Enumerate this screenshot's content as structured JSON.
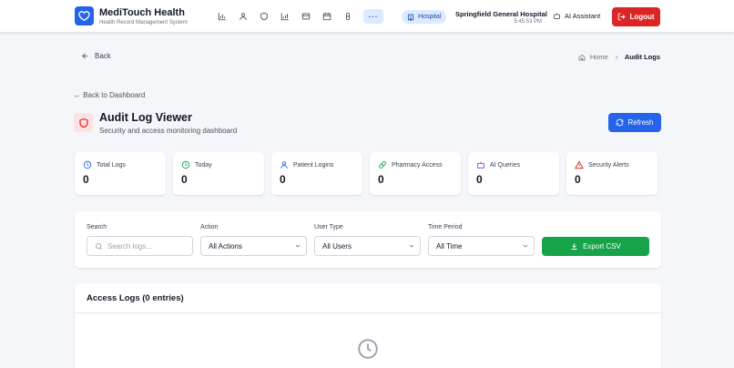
{
  "app": {
    "title": "MediTouch Health",
    "subtitle": "Health Record Management System",
    "nav_icons": [
      "bar-chart-icon",
      "user-icon",
      "shield-icon",
      "bar-chart-icon",
      "credit-card-icon",
      "calendar-icon",
      "pill-icon"
    ],
    "nav_more_label": "···",
    "hospital_badge": "Hospital",
    "hospital_name": "Springfield General Hospital",
    "time": "5:45:53 PM",
    "ai_assistant_label": "AI Assistant",
    "logout_label": "Logout"
  },
  "nav": {
    "back_label": "Back",
    "breadcrumb": {
      "home": "Home",
      "current": "Audit Logs"
    },
    "back_to_dashboard": "← Back to Dashboard"
  },
  "header": {
    "title": "Audit Log Viewer",
    "subtitle": "Security and access monitoring dashboard",
    "refresh_label": "Refresh"
  },
  "stats": [
    {
      "label": "Total Logs",
      "value": "0",
      "icon": "clock-icon",
      "color": "#2563eb"
    },
    {
      "label": "Today",
      "value": "0",
      "icon": "clock-icon",
      "color": "#16a34a"
    },
    {
      "label": "Patient Logins",
      "value": "0",
      "icon": "user-icon",
      "color": "#2563eb"
    },
    {
      "label": "Pharmacy Access",
      "value": "0",
      "icon": "pill-icon",
      "color": "#16a34a"
    },
    {
      "label": "AI Queries",
      "value": "0",
      "icon": "bot-icon",
      "color": "#7c3aed"
    },
    {
      "label": "Security Alerts",
      "value": "0",
      "icon": "warning-icon",
      "color": "#dc2626"
    }
  ],
  "filters": {
    "search_label": "Search",
    "search_placeholder": "Search logs...",
    "action_label": "Action",
    "action_value": "All Actions",
    "user_type_label": "User Type",
    "user_type_value": "All Users",
    "time_period_label": "Time Period",
    "time_period_value": "All Time",
    "export_label": "Export CSV"
  },
  "logs": {
    "title": "Access Logs (0 entries)"
  },
  "colors": {
    "primary": "#2563eb",
    "danger": "#dc2626",
    "success": "#16a34a",
    "background": "#f4f6f9"
  }
}
